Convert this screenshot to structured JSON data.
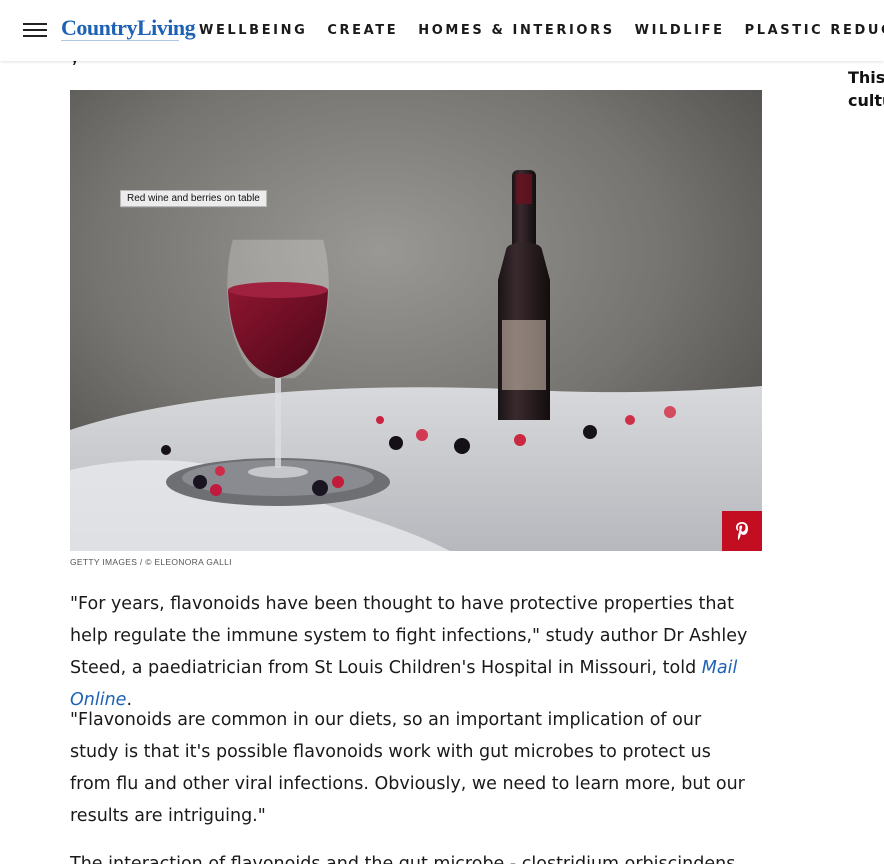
{
  "header": {
    "logo": "CountryLiving",
    "nav": [
      "WELLBEING",
      "CREATE",
      "HOMES & INTERIORS",
      "WILDLIFE",
      "PLASTIC REDUCTION"
    ]
  },
  "rail": {
    "line1": "This",
    "line2": "cultu"
  },
  "prev_sliver": "y",
  "figure": {
    "tag": "Red wine and berries on table",
    "caption": "GETTY IMAGES / © ELEONORA GALLI"
  },
  "article": {
    "p1_before": "\"For years, flavonoids have been thought to have protective properties that help regulate the immune system to fight infections,\" study author Dr Ashley Steed, a paediatrician from St Louis Children's Hospital in Missouri, told ",
    "p1_link": "Mail Online",
    "p1_after": ".",
    "p2": "\"Flavonoids are common in our diets, so an important implication of our study is that it's possible flavonoids work with gut microbes to protect us from flu and other viral infections. Obviously, we need to learn more, but our results are intriguing.\"",
    "p3": "The interaction of flavonoids and the gut microbe - clostridium orbiscindens"
  },
  "colors": {
    "brand": "#1e62b4",
    "pinterest": "#c30d21"
  },
  "icons": {
    "menu": "hamburger-icon",
    "pin": "pinterest-icon"
  }
}
